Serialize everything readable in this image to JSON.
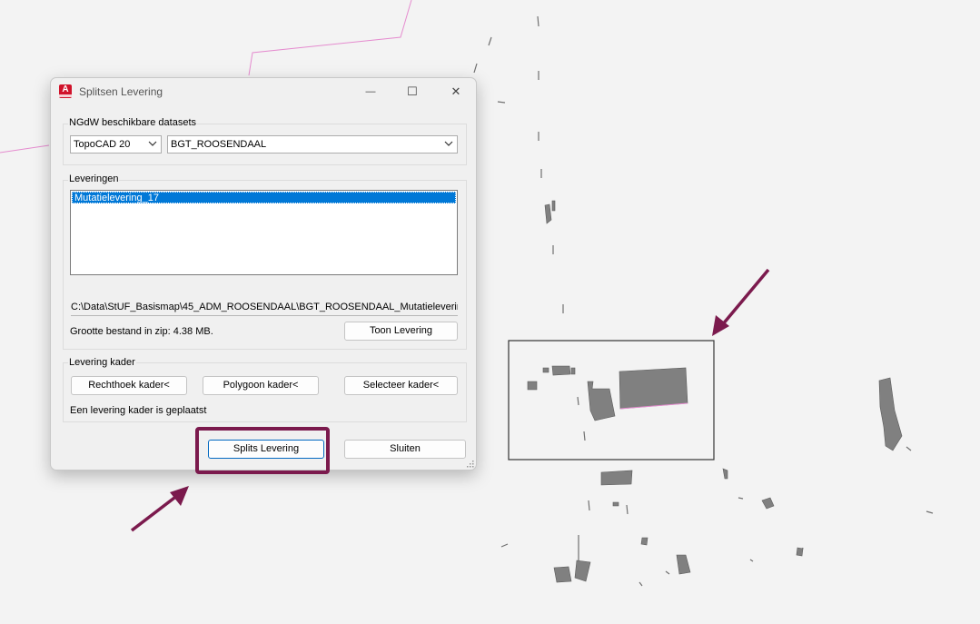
{
  "dialog": {
    "title": "Splitsen Levering",
    "app_icon_letter": "A",
    "controls": {
      "minimize": "—",
      "maximize": "☐",
      "close": "✕"
    }
  },
  "datasets": {
    "label": "NGdW beschikbare datasets",
    "product_value": "TopoCAD 20",
    "dataset_value": "BGT_ROOSENDAAL"
  },
  "leveringen": {
    "label": "Leveringen",
    "items": [
      "Mutatielevering_17"
    ],
    "path": "C:\\Data\\StUF_Basismap\\45_ADM_ROOSENDAAL\\BGT_ROOSENDAAL_Mutatieleverir",
    "size_text": "Grootte bestand in zip: 4.38 MB.",
    "toon_button": "Toon Levering"
  },
  "kader": {
    "label": "Levering kader",
    "rechthoek_button": "Rechthoek kader<",
    "polygoon_button": "Polygoon kader<",
    "selecteer_button": "Selecteer kader<",
    "status_text": "Een levering kader is geplaatst"
  },
  "footer": {
    "split_button": "Splits Levering",
    "close_button": "Sluiten"
  },
  "colors": {
    "annotation": "#7b1a4d",
    "selection": "#0078d7",
    "buildings": "#808080",
    "parcel_line": "#e58ccf"
  }
}
